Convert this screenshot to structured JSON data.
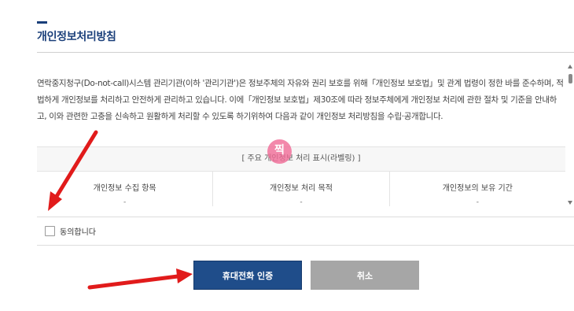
{
  "section": {
    "title": "개인정보처리방침"
  },
  "policy": {
    "intro_text": "연락중지청구(Do-not-call)시스템 관리기관(이하 '관리기관')은 정보주체의 자유와 권리 보호를 위해「개인정보 보호법」및 관계 법령이 정한 바를 준수하며, 적법하게 개인정보를 처리하고 안전하게 관리하고 있습니다. 이에「개인정보 보호법」제30조에 따라 정보주체에게 개인정보 처리에 관한 절차 및 기준을 안내하고, 이와 관련한 고충을 신속하고 원활하게 처리할 수 있도록 하기위하여 다음과 같이 개인정보 처리방침을 수립·공개합니다.",
    "label_table": {
      "header": "[ 주요 개인정보 처리 표시(라벨링) ]",
      "columns": [
        {
          "title": "개인정보 수집 항목",
          "value": "-"
        },
        {
          "title": "개인정보 처리 목적",
          "value": "-"
        },
        {
          "title": "개인정보의 보유 기간",
          "value": "-"
        }
      ]
    }
  },
  "agreement": {
    "checkbox_label": "동의합니다",
    "checked": false
  },
  "buttons": {
    "verify_label": "휴대전화 인증",
    "cancel_label": "취소"
  },
  "watermark": {
    "text": "찍"
  },
  "colors": {
    "brand_navy": "#1a3f7a",
    "primary_button": "#1f4d8a",
    "cancel_button": "#a6a6a6",
    "annotation_arrow": "#e11b1b",
    "watermark_pink": "#f06a96"
  }
}
